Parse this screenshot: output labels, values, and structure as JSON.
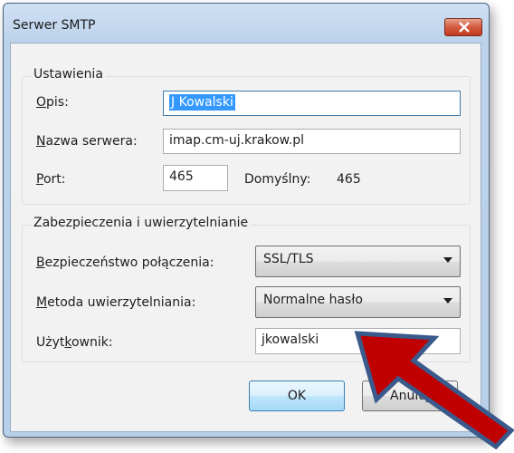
{
  "window": {
    "title": "Serwer SMTP"
  },
  "settings_group": {
    "title": "Ustawienia",
    "description": {
      "label_accel": "O",
      "label_rest": "pis:",
      "value": "J Kowalski"
    },
    "server_name": {
      "label_accel": "N",
      "label_rest": "azwa serwera:",
      "value": "imap.cm-uj.krakow.pl"
    },
    "port": {
      "label_accel": "P",
      "label_rest": "ort:",
      "value": "465",
      "default_label": "Domyślny:",
      "default_value": "465"
    }
  },
  "security_group": {
    "title": "Zabezpieczenia i uwierzytelnianie",
    "connection_security": {
      "label_accel": "B",
      "label_rest": "ezpieczeństwo połączenia:",
      "value": "SSL/TLS"
    },
    "auth_method": {
      "label_accel": "M",
      "label_rest": "etoda uwierzytelniania:",
      "value": "Normalne hasło"
    },
    "username": {
      "label_pre": "Użyt",
      "label_accel": "k",
      "label_rest": "ownik:",
      "value": "jkowalski"
    }
  },
  "buttons": {
    "ok": "OK",
    "cancel": "Anuluj"
  },
  "colors": {
    "arrow_fill": "#c00000",
    "arrow_stroke": "#3a5a8c",
    "selection": "#3399ff"
  }
}
